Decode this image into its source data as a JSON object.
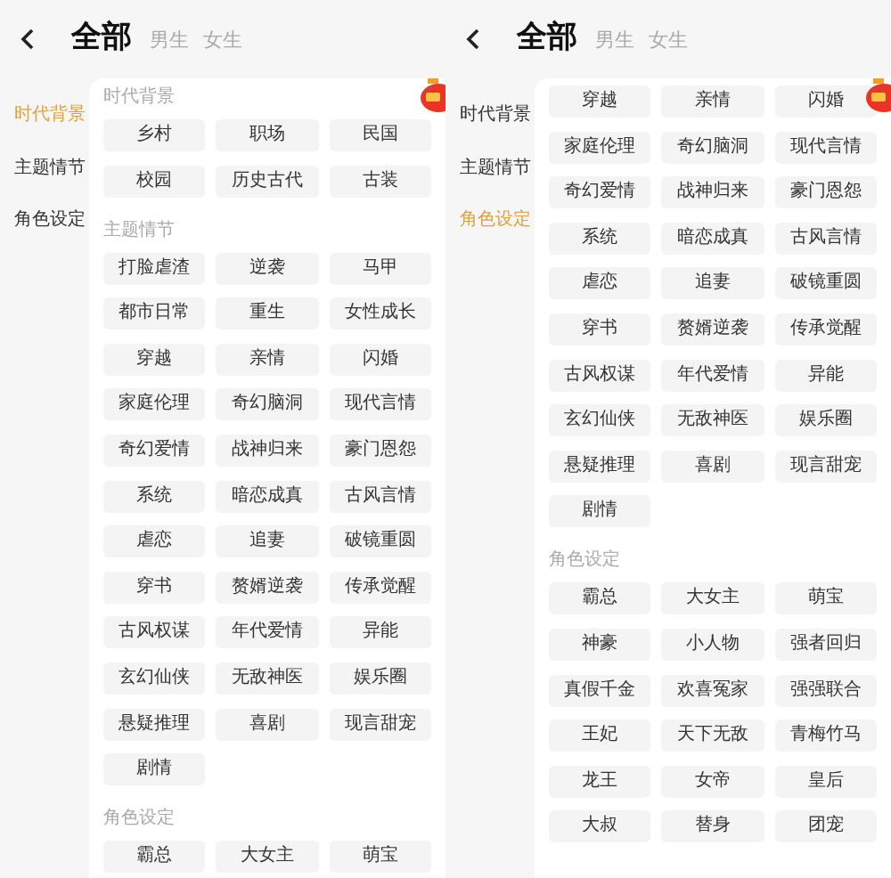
{
  "panels": [
    {
      "tabs": [
        {
          "label": "全部",
          "selected": true
        },
        {
          "label": "男生",
          "selected": false
        },
        {
          "label": "女生",
          "selected": false
        }
      ],
      "sidebar": [
        {
          "label": "时代背景",
          "selected": true
        },
        {
          "label": "主题情节",
          "selected": false
        },
        {
          "label": "角色设定",
          "selected": false
        }
      ],
      "sections": [
        {
          "title": "时代背景",
          "tags": [
            "乡村",
            "职场",
            "民国",
            "校园",
            "历史古代",
            "古装"
          ]
        },
        {
          "title": "主题情节",
          "tags": [
            "打脸虐渣",
            "逆袭",
            "马甲",
            "都市日常",
            "重生",
            "女性成长",
            "穿越",
            "亲情",
            "闪婚",
            "家庭伦理",
            "奇幻脑洞",
            "现代言情",
            "奇幻爱情",
            "战神归来",
            "豪门恩怨",
            "系统",
            "暗恋成真",
            "古风言情",
            "虐恋",
            "追妻",
            "破镜重圆",
            "穿书",
            "赘婿逆袭",
            "传承觉醒",
            "古风权谋",
            "年代爱情",
            "异能",
            "玄幻仙侠",
            "无敌神医",
            "娱乐圈",
            "悬疑推理",
            "喜剧",
            "现言甜宠",
            "剧情"
          ]
        },
        {
          "title": "角色设定",
          "tags": [
            "霸总",
            "大女主",
            "萌宝"
          ]
        }
      ]
    },
    {
      "tabs": [
        {
          "label": "全部",
          "selected": true
        },
        {
          "label": "男生",
          "selected": false
        },
        {
          "label": "女生",
          "selected": false
        }
      ],
      "sidebar": [
        {
          "label": "时代背景",
          "selected": false
        },
        {
          "label": "主题情节",
          "selected": false
        },
        {
          "label": "角色设定",
          "selected": true
        }
      ],
      "sections": [
        {
          "tags": [
            "穿越",
            "亲情",
            "闪婚",
            "家庭伦理",
            "奇幻脑洞",
            "现代言情",
            "奇幻爱情",
            "战神归来",
            "豪门恩怨",
            "系统",
            "暗恋成真",
            "古风言情",
            "虐恋",
            "追妻",
            "破镜重圆",
            "穿书",
            "赘婿逆袭",
            "传承觉醒",
            "古风权谋",
            "年代爱情",
            "异能",
            "玄幻仙侠",
            "无敌神医",
            "娱乐圈",
            "悬疑推理",
            "喜剧",
            "现言甜宠",
            "剧情"
          ]
        },
        {
          "title": "角色设定",
          "tags": [
            "霸总",
            "大女主",
            "萌宝",
            "神豪",
            "小人物",
            "强者回归",
            "真假千金",
            "欢喜冤家",
            "强强联合",
            "王妃",
            "天下无敌",
            "青梅竹马",
            "龙王",
            "女帝",
            "皇后",
            "大叔",
            "替身",
            "团宠"
          ]
        }
      ]
    }
  ]
}
